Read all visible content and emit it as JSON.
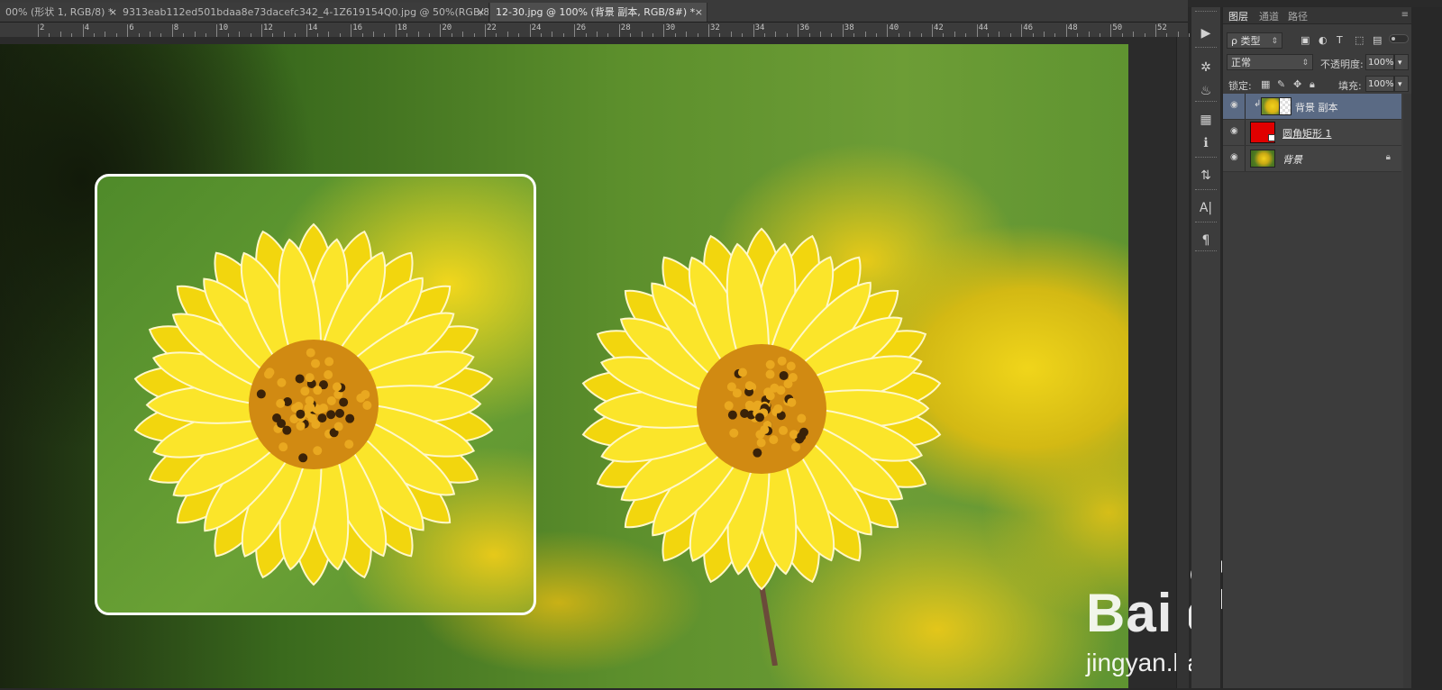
{
  "tabs": [
    {
      "label": "00% (形状 1, RGB/8) *",
      "close": "×",
      "active": false
    },
    {
      "label": "9313eab112ed501bdaa8e73dacefc342_4-1Z619154Q0.jpg @ 50%(RGB/8#) *",
      "close": "×",
      "active": false
    },
    {
      "label": "12-30.jpg @ 100% (背景 副本, RGB/8#) *",
      "close": "×",
      "active": true
    }
  ],
  "ruler": {
    "labels": [
      "2",
      "4",
      "6",
      "8",
      "10",
      "12",
      "14",
      "16",
      "18",
      "20",
      "22",
      "24",
      "26",
      "28",
      "30",
      "32",
      "34",
      "36",
      "38",
      "40",
      "42",
      "44",
      "46",
      "48",
      "50",
      "52"
    ]
  },
  "tools": [
    {
      "name": "play-icon",
      "glyph": "▶"
    },
    {
      "name": "brush-settings-icon",
      "glyph": "✲"
    },
    {
      "name": "clone-source-icon",
      "glyph": "♨"
    },
    {
      "name": "adjustments-icon",
      "glyph": "▦"
    },
    {
      "name": "info-icon",
      "glyph": "ℹ"
    },
    {
      "name": "layer-comps-icon",
      "glyph": "⇅"
    },
    {
      "name": "character-icon",
      "glyph": "A|"
    },
    {
      "name": "paragraph-icon",
      "glyph": "¶"
    }
  ],
  "layers_panel": {
    "tabs": [
      "图层",
      "通道",
      "路径"
    ],
    "menu_glyph": "≡",
    "filter_kind": "ρ 类型",
    "blend_mode": "正常",
    "opacity_label": "不透明度:",
    "opacity_value": "100%",
    "lock_label": "锁定:",
    "fill_label": "填充:",
    "fill_value": "100%",
    "layers": [
      {
        "name": "背景 副本",
        "selected": true,
        "type": "image-mask"
      },
      {
        "name": "圆角矩形 1",
        "selected": false,
        "type": "shape"
      },
      {
        "name": "背景",
        "selected": false,
        "type": "background",
        "locked": true
      }
    ]
  },
  "watermark": {
    "brand": "Bai",
    "brand2": "du",
    "cn": "经验",
    "url": "jingyan.baidu.com"
  },
  "colors": {
    "selected_layer": "#5a6a84",
    "shape_layer_fill": "#e00000",
    "panel_bg": "#3c3c3c"
  }
}
